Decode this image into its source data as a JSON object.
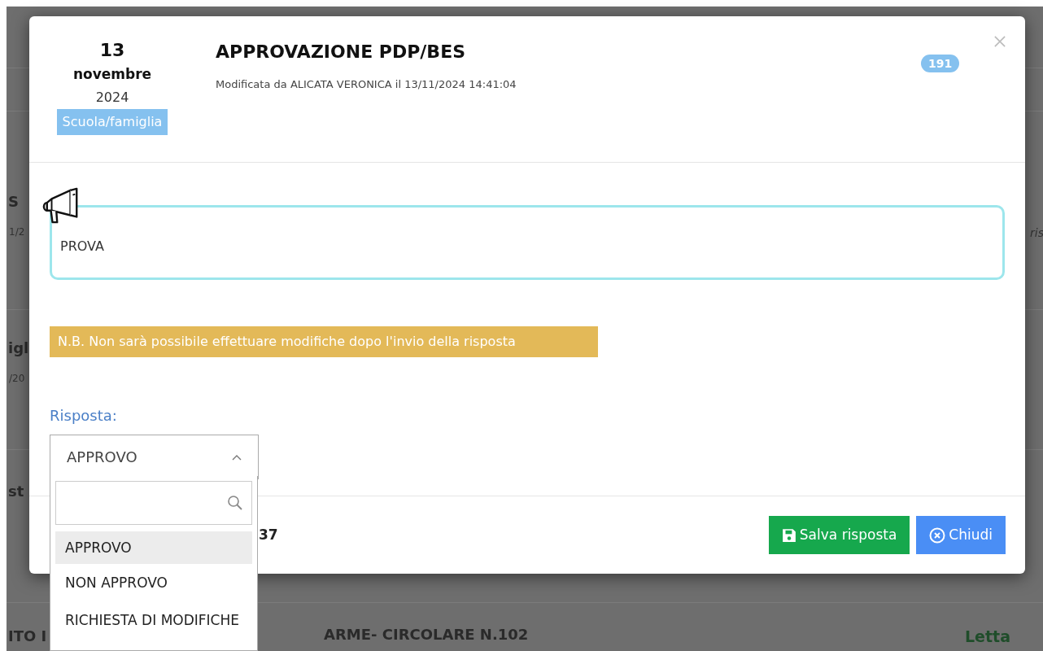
{
  "background": {
    "fragments": [
      {
        "text": "S",
        "kind": "heading"
      },
      {
        "text": "1/2",
        "kind": "meta"
      },
      {
        "text": "ris",
        "kind": "note"
      },
      {
        "text": "igl",
        "kind": "heading"
      },
      {
        "text": "/20",
        "kind": "meta"
      },
      {
        "text": "st",
        "kind": "heading"
      },
      {
        "text": "ITO I",
        "kind": "heading"
      },
      {
        "text": "ARME- CIRCOLARE N.102",
        "kind": "heading"
      },
      {
        "text": "Letta",
        "kind": "status"
      }
    ]
  },
  "modal": {
    "date": {
      "day": "13",
      "month": "novembre",
      "year": "2024"
    },
    "category": "Scuola/famiglia",
    "title": "APPROVAZIONE PDP/BES",
    "modified": "Modificata da ALICATA VERONICA il 13/11/2024 14:41:04",
    "count_badge": "191",
    "message": "PROVA",
    "notice": "N.B. Non sarà possibile effettuare modifiche dopo l'invio della risposta",
    "response": {
      "label": "Risposta:",
      "value": "APPROVO",
      "expanded": true,
      "options": [
        {
          "label": "APPROVO",
          "selected": true
        },
        {
          "label": "NON APPROVO",
          "selected": false
        },
        {
          "label": "RICHIESTA DI MODIFICHE",
          "selected": false
        }
      ]
    },
    "footer_text": "37",
    "buttons": [
      {
        "label": "Salva risposta",
        "kind": "save"
      },
      {
        "label": "Chiudi",
        "kind": "close"
      }
    ]
  }
}
